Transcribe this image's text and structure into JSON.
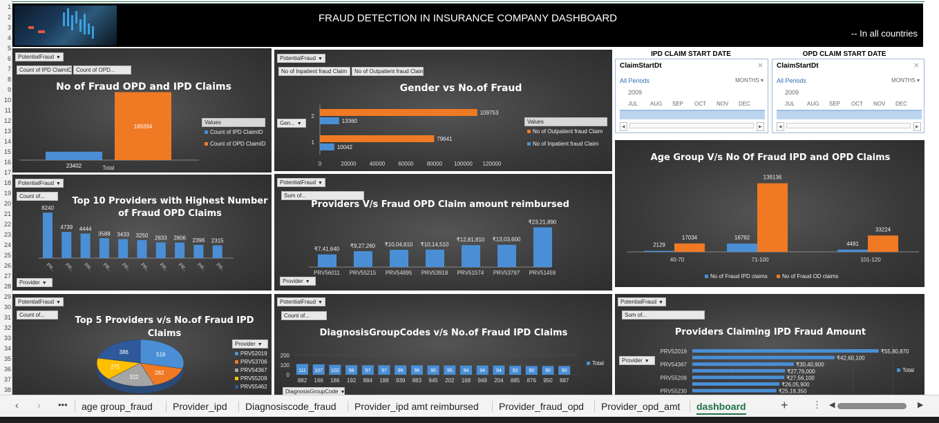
{
  "dashboard": {
    "title": "FRAUD DETECTION IN INSURANCE COMPANY DASHBOARD",
    "subtitle": "-- In all countries"
  },
  "row_numbers": [
    "1",
    "2",
    "3",
    "4",
    "5",
    "6",
    "7",
    "8",
    "9",
    "10",
    "11",
    "12",
    "13",
    "14",
    "15",
    "16",
    "17",
    "18",
    "19",
    "20",
    "21",
    "22",
    "23",
    "24",
    "25",
    "26",
    "27",
    "28",
    "29",
    "30",
    "31",
    "32",
    "33",
    "34",
    "35",
    "36",
    "37",
    "38"
  ],
  "filters": {
    "potential_fraud": "PotentialFraud",
    "provider": "Provider",
    "gender": "Gen...",
    "diag_group": "DiagnosisGroupCode"
  },
  "panel1": {
    "title": "No of Fraud OPD and IPD Claims",
    "btn1": "Count of IPD ClaimID",
    "btn2": "Count of OPD...",
    "legend_title": "Values",
    "legend": [
      "Count of IPD ClaimID",
      "Count of OPD ClaimID"
    ]
  },
  "panel2": {
    "title": "Gender vs No.of Fraud",
    "btn1": "No of Inpatient fraud Claim",
    "btn2": "No of Outpatient fraud Claim",
    "legend_title": "Values",
    "legend": [
      "No of Outpatient fraud Claim",
      "No of Inpatient fraud Claim"
    ]
  },
  "panel4": {
    "title": "Top 10 Providers with Highest Number of Fraud OPD Claims",
    "btn1": "Count of..."
  },
  "panel5": {
    "title": "Providers V/s Fraud OPD Claim amount reimbursed",
    "btn1": "Sum of..."
  },
  "panel6": {
    "title": "Age Group V/s No Of Fraud IPD and OPD Claims",
    "legend": [
      "No of Fraud IPD claims",
      "No of Fraud OD claims"
    ]
  },
  "panel7": {
    "title": "Top 5 Providers v/s  No.of Fraud IPD Claims",
    "btn1": "Count of...",
    "legend_title": "Provider"
  },
  "panel8": {
    "title": "DiagnosisGroupCodes v/s  No.of Fraud IPD Claims",
    "btn1": "Count of...",
    "legend": "Total"
  },
  "panel9": {
    "title": "Providers Claiming IPD Fraud Amount",
    "btn1": "Sum of...",
    "legend": "Total"
  },
  "slicer1": {
    "header": "IPD CLAIM START DATE",
    "field": "ClaimStartDt",
    "all_periods": "All Periods",
    "level": "MONTHS",
    "year": "2009",
    "months": [
      "JUL",
      "AUG",
      "SEP",
      "OCT",
      "NOV",
      "DEC"
    ]
  },
  "slicer2": {
    "header": "OPD CLAIM START DATE",
    "field": "ClaimStartDt",
    "all_periods": "All Periods",
    "level": "MONTHS",
    "year": "2009",
    "months": [
      "JUL",
      "AUG",
      "SEP",
      "OCT",
      "NOV",
      "DEC"
    ]
  },
  "tabs": [
    "age group_fraud",
    "Provider_ipd",
    "Diagnosiscode_fraud",
    "Provider_ipd amt reimbursed",
    "Provider_fraud_opd",
    "Provider_opd_amt",
    "dashboard"
  ],
  "active_tab": "dashboard",
  "colors": {
    "blue": "#4a8fd6",
    "orange": "#f07a24",
    "gray": "#a5a5a5",
    "yellow": "#ffc000",
    "navy": "#2e5a9c"
  },
  "chart_data": [
    {
      "type": "bar",
      "title": "No of Fraud OPD and IPD Claims",
      "categories": [
        "Total"
      ],
      "series": [
        {
          "name": "Count of IPD ClaimID",
          "values": [
            23402
          ]
        },
        {
          "name": "Count of OPD ClaimID",
          "values": [
            189394
          ]
        }
      ]
    },
    {
      "type": "bar",
      "orientation": "horizontal",
      "title": "Gender vs No.of Fraud",
      "categories": [
        "1",
        "2"
      ],
      "x_ticks": [
        "0",
        "20000",
        "40000",
        "60000",
        "80000",
        "100000",
        "120000"
      ],
      "xlim": [
        0,
        120000
      ],
      "series": [
        {
          "name": "No of Outpatient fraud Claim",
          "values": [
            79641,
            109753
          ]
        },
        {
          "name": "No of Inpatient fraud Claim",
          "values": [
            10042,
            13360
          ]
        }
      ]
    },
    {
      "type": "bar",
      "title": "Top 10 Providers with Highest Number of Fraud OPD Claims",
      "categories": [
        "PR..",
        "PR..",
        "PR..",
        "PR..",
        "PR..",
        "PR..",
        "PR..",
        "PR..",
        "PR..",
        "PR.."
      ],
      "values": [
        8240,
        4739,
        4444,
        3588,
        3433,
        3250,
        2833,
        2806,
        2396,
        2315
      ]
    },
    {
      "type": "bar",
      "title": "Providers V/s Fraud OPD Claim amount reimbursed",
      "categories": [
        "PRV56011",
        "PRV55215",
        "PRV54895",
        "PRV53918",
        "PRV51574",
        "PRV53797",
        "PRV51459"
      ],
      "values": [
        741640,
        927260,
        1004610,
        1014510,
        1281810,
        1303600,
        2321890
      ],
      "labels": [
        "₹7,41,640",
        "₹9,27,260",
        "₹10,04,610",
        "₹10,14,510",
        "₹12,81,810",
        "₹13,03,600",
        "₹23,21,890"
      ]
    },
    {
      "type": "bar",
      "title": "Age Group V/s No Of Fraud IPD and OPD Claims",
      "categories": [
        "40-70",
        "71-100",
        "101-120"
      ],
      "series": [
        {
          "name": "No of Fraud IPD claims",
          "values": [
            2129,
            16792,
            4481
          ]
        },
        {
          "name": "No of Fraud OD claims",
          "values": [
            17034,
            139136,
            33224
          ]
        }
      ]
    },
    {
      "type": "pie",
      "title": "Top 5 Providers v/s  No.of Fraud IPD Claims",
      "categories": [
        "PRV52019",
        "PRV53706",
        "PRV54367",
        "PRV55209",
        "PRV55462"
      ],
      "values": [
        516,
        282,
        322,
        275,
        386
      ]
    },
    {
      "type": "bar",
      "title": "DiagnosisGroupCodes v/s  No.of Fraud IPD Claims",
      "categories": [
        "882",
        "166",
        "186",
        "192",
        "884",
        "188",
        "939",
        "883",
        "945",
        "202",
        "168",
        "949",
        "204",
        "885",
        "876",
        "950",
        "887"
      ],
      "values": [
        111,
        107,
        102,
        98,
        97,
        97,
        96,
        96,
        95,
        95,
        94,
        94,
        94,
        92,
        90,
        90,
        90
      ],
      "y_ticks": [
        "0",
        "100",
        "200"
      ],
      "ylim": [
        0,
        200
      ]
    },
    {
      "type": "bar",
      "orientation": "horizontal",
      "title": "Providers Claiming IPD Fraud Amount",
      "categories": [
        "PRV52019",
        "PRV54367",
        "PRV55209",
        "PRV55230"
      ],
      "values": [
        5580870,
        4260100,
        3040900,
        2776000,
        2756100,
        2605900,
        2518350
      ],
      "labels": [
        "₹55,80,870",
        "₹42,60,100",
        "₹30,40,900",
        "₹27,76,000",
        "₹27,56,100",
        "₹26,05,900",
        "₹25,18,350"
      ]
    }
  ]
}
